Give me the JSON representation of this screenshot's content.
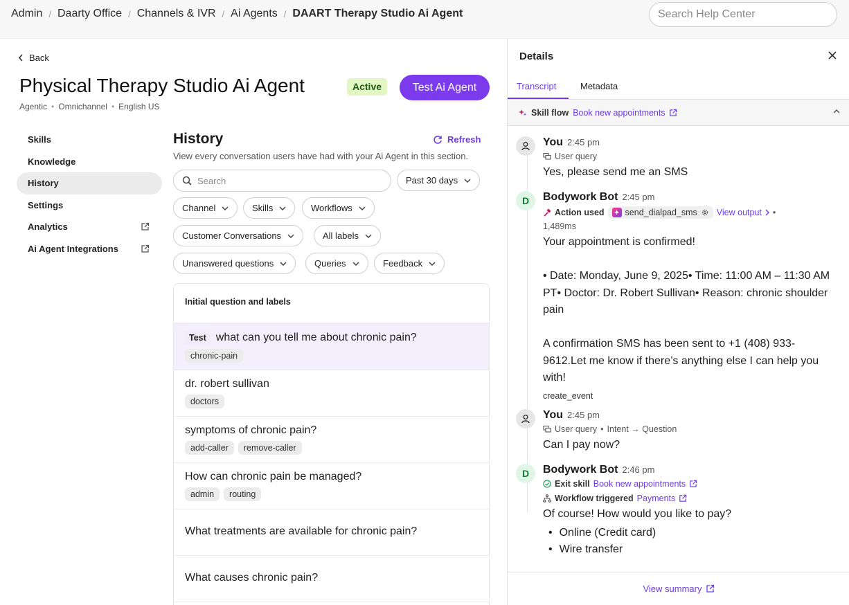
{
  "breadcrumb": {
    "items": [
      "Admin",
      "Daarty Office",
      "Channels & IVR",
      "Ai Agents",
      "DAART Therapy Studio Ai Agent"
    ],
    "separator": "/"
  },
  "search_help": {
    "placeholder": "Search Help Center"
  },
  "header": {
    "back_label": "Back",
    "title": "Physical Therapy Studio Ai Agent",
    "status_badge": "Active",
    "test_button": "Test Ai Agent",
    "subtitle": [
      "Agentic",
      "Omnichannel",
      "English US"
    ]
  },
  "sidenav": {
    "items": [
      {
        "label": "Skills",
        "external": false,
        "active": false
      },
      {
        "label": "Knowledge",
        "external": false,
        "active": false
      },
      {
        "label": "History",
        "external": false,
        "active": true
      },
      {
        "label": "Settings",
        "external": false,
        "active": false
      },
      {
        "label": "Analytics",
        "external": true,
        "active": false
      },
      {
        "label": "Ai Agent Integrations",
        "external": true,
        "active": false
      }
    ]
  },
  "history": {
    "title": "History",
    "refresh_label": "Refresh",
    "description": "View every conversation users have had with your Ai Agent in this section.",
    "search_placeholder": "Search",
    "date_filter": "Past 30 days",
    "filters": [
      "Channel",
      "Skills",
      "Workflows",
      "Customer Conversations",
      "All labels",
      "Unanswered questions",
      "Queries",
      "Feedback"
    ],
    "list_header": "Initial question and labels",
    "rows": [
      {
        "test_tag": "Test",
        "question": "what can you tell me about chronic pain?",
        "tags": [
          "chronic-pain"
        ]
      },
      {
        "question": "dr. robert sullivan",
        "tags": [
          "doctors"
        ]
      },
      {
        "question": "symptoms of chronic pain?",
        "tags": [
          "add-caller",
          "remove-caller"
        ]
      },
      {
        "question": "How can chronic pain be managed?",
        "tags": [
          "admin",
          "routing"
        ]
      },
      {
        "question": "What treatments are available for chronic pain?",
        "tags": []
      },
      {
        "question": "What causes chronic pain?",
        "tags": []
      }
    ]
  },
  "details": {
    "title": "Details",
    "tabs": [
      "Transcript",
      "Metadata"
    ],
    "active_tab": "Transcript",
    "skill_flow": {
      "label": "Skill flow",
      "link": "Book new appointments"
    },
    "messages": [
      {
        "sender": "You",
        "time": "2:45 pm",
        "meta_label": "User query",
        "text": "Yes, please send me an SMS"
      },
      {
        "sender": "Bodywork Bot",
        "avatar": "D",
        "time": "2:45 pm",
        "action_label": "Action used",
        "action_chip": "send_dialpad_sms",
        "view_output": "View output",
        "duration": "1,489ms",
        "text_1": "Your appointment is confirmed!",
        "text_2": "• Date: Monday, June 9, 2025• Time: 11:00 AM – 11:30 AM PT• Doctor: Dr. Robert Sullivan• Reason: chronic shoulder pain",
        "text_3": "A confirmation SMS has been sent to +1 (408) 933-9612.Let me know if there’s anything else I can help you with!",
        "event": "create_event"
      },
      {
        "sender": "You",
        "time": "2:45 pm",
        "meta_label": "User query",
        "intent": "Intent → Question",
        "text": "Can I pay now?"
      },
      {
        "sender": "Bodywork Bot",
        "avatar": "D",
        "time": "2:46 pm",
        "exit_label": "Exit skill",
        "exit_link": "Book new appointments",
        "workflow_label": "Workflow triggered",
        "workflow_link": "Payments",
        "text": "Of course! How would you like to pay?",
        "options": [
          "Online (Credit card)",
          "Wire transfer"
        ]
      }
    ],
    "footer_link": "View summary"
  },
  "colors": {
    "accent": "#7c3aed",
    "link": "#6d3de0",
    "active_badge_bg": "#e3f7c4",
    "selected_row_bg": "#f4effd"
  }
}
